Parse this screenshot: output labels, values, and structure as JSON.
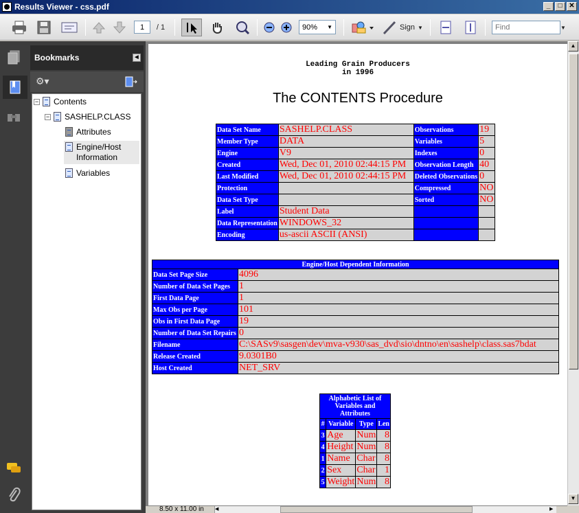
{
  "window": {
    "title": "Results Viewer - css.pdf",
    "minimize": "_",
    "maximize": "□",
    "close": "✕"
  },
  "toolbar": {
    "page_current": "1",
    "page_total": "/ 1",
    "zoom": "90%",
    "sign_label": "Sign",
    "find_placeholder": "Find"
  },
  "bookmarks": {
    "title": "Bookmarks",
    "items": [
      {
        "label": "Contents"
      },
      {
        "label": "SASHELP.CLASS"
      },
      {
        "label": "Attributes"
      },
      {
        "label": "Engine/Host",
        "label2": "Information"
      },
      {
        "label": "Variables"
      }
    ]
  },
  "status": {
    "page_size": "8.50 x 11.00 in"
  },
  "document": {
    "heading1": "Leading Grain Producers",
    "heading2": "in 1996",
    "proc_title": "The CONTENTS Procedure",
    "attributes": [
      {
        "l1": "Data Set Name",
        "v1": "SASHELP.CLASS",
        "l2": "Observations",
        "v2": "19"
      },
      {
        "l1": "Member Type",
        "v1": "DATA",
        "l2": "Variables",
        "v2": "5"
      },
      {
        "l1": "Engine",
        "v1": "V9",
        "l2": "Indexes",
        "v2": "0"
      },
      {
        "l1": "Created",
        "v1": "Wed, Dec 01, 2010 02:44:15 PM",
        "l2": "Observation Length",
        "v2": "40"
      },
      {
        "l1": "Last Modified",
        "v1": "Wed, Dec 01, 2010 02:44:15 PM",
        "l2": "Deleted Observations",
        "v2": "0"
      },
      {
        "l1": "Protection",
        "v1": "",
        "l2": "Compressed",
        "v2": "NO"
      },
      {
        "l1": "Data Set Type",
        "v1": "",
        "l2": "Sorted",
        "v2": "NO"
      },
      {
        "l1": "Label",
        "v1": "Student Data",
        "l2": "",
        "v2": ""
      },
      {
        "l1": "Data Representation",
        "v1": "WINDOWS_32",
        "l2": "",
        "v2": ""
      },
      {
        "l1": "Encoding",
        "v1": "us-ascii  ASCII (ANSI)",
        "l2": "",
        "v2": ""
      }
    ],
    "engine_title": "Engine/Host Dependent Information",
    "engine": [
      {
        "l": "Data Set Page Size",
        "v": "4096"
      },
      {
        "l": "Number of Data Set Pages",
        "v": "1"
      },
      {
        "l": "First Data Page",
        "v": "1"
      },
      {
        "l": "Max Obs per Page",
        "v": "101"
      },
      {
        "l": "Obs in First Data Page",
        "v": "19"
      },
      {
        "l": "Number of Data Set Repairs",
        "v": "0"
      },
      {
        "l": "Filename",
        "v": "C:\\SASv9\\sasgen\\dev\\mva-v930\\sas_dvd\\sio\\dntno\\en\\sashelp\\class.sas7bdat"
      },
      {
        "l": "Release Created",
        "v": "9.0301B0"
      },
      {
        "l": "Host Created",
        "v": "NET_SRV"
      }
    ],
    "vars_title": "Alphabetic List of Variables and Attributes",
    "vars_cols": [
      "#",
      "Variable",
      "Type",
      "Len"
    ],
    "vars": [
      {
        "n": "3",
        "name": "Age",
        "type": "Num",
        "len": "8"
      },
      {
        "n": "4",
        "name": "Height",
        "type": "Num",
        "len": "8"
      },
      {
        "n": "1",
        "name": "Name",
        "type": "Char",
        "len": "8"
      },
      {
        "n": "2",
        "name": "Sex",
        "type": "Char",
        "len": "1"
      },
      {
        "n": "5",
        "name": "Weight",
        "type": "Num",
        "len": "8"
      }
    ]
  }
}
